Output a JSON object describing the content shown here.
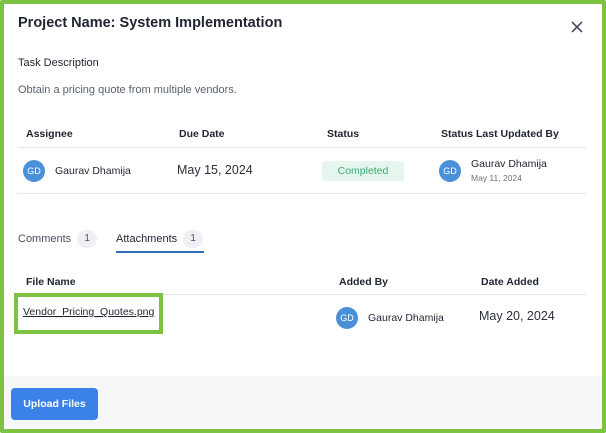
{
  "modal": {
    "title": "Project Name: System Implementation",
    "close_icon": "close-icon"
  },
  "task": {
    "section_label": "Task Description",
    "description": "Obtain a pricing quote from multiple vendors."
  },
  "task_table": {
    "headers": [
      "Assignee",
      "Due Date",
      "Status",
      "Status Last Updated By"
    ],
    "row": {
      "assignee_initials": "GD",
      "assignee_name": "Gaurav Dhamija",
      "due_date": "May 15, 2024",
      "status": "Completed",
      "updated_by_initials": "GD",
      "updated_by_name": "Gaurav Dhamija",
      "updated_on": "May 11, 2024"
    },
    "status_colors": {
      "completed_bg": "#e6f6ee",
      "completed_text": "#3aa870"
    }
  },
  "tabs": [
    {
      "label": "Comments",
      "count": "1",
      "active": false
    },
    {
      "label": "Attachments",
      "count": "1",
      "active": true
    }
  ],
  "attachments_table": {
    "headers": [
      "File Name",
      "Added By",
      "Date Added"
    ],
    "rows": [
      {
        "file_name": "Vendor_Pricing_Quotes.png",
        "added_by_initials": "GD",
        "added_by_name": "Gaurav Dhamija",
        "date_added": "May 20, 2024"
      }
    ]
  },
  "footer": {
    "upload_label": "Upload Files"
  },
  "colors": {
    "accent": "#3b82e8",
    "highlight": "#7cc243",
    "avatar": "#4a90d9"
  }
}
